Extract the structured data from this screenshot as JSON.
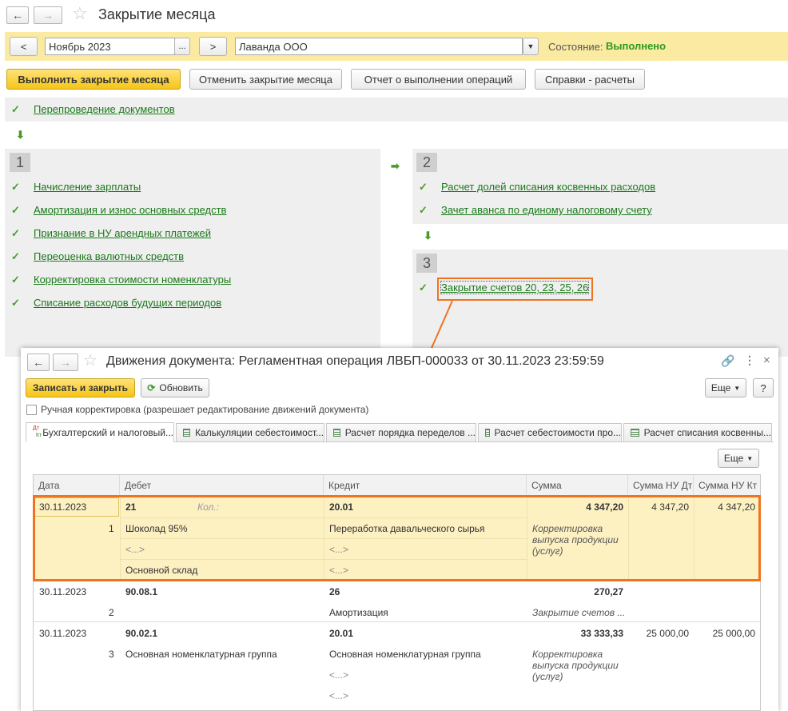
{
  "window": {
    "title": "Закрытие месяца"
  },
  "filters": {
    "prev": "<",
    "period": "Ноябрь 2023",
    "period_btn": "...",
    "next": ">",
    "org": "Лаванда ООО",
    "status_label": "Состояние:",
    "status_value": "Выполнено"
  },
  "toolbar": {
    "run": "Выполнить закрытие месяца",
    "cancel": "Отменить закрытие месяца",
    "report": "Отчет о выполнении операций",
    "refs": "Справки - расчеты"
  },
  "top_op": "Перепроведение документов",
  "block1": {
    "num": "1",
    "items": [
      "Начисление зарплаты",
      "Амортизация и износ основных средств",
      "Признание в НУ арендных платежей",
      "Переоценка валютных средств",
      "Корректировка стоимости номенклатуры",
      "Списание расходов будущих периодов"
    ]
  },
  "block2": {
    "num": "2",
    "items": [
      "Расчет долей списания косвенных расходов",
      "Зачет аванса по единому налоговому счету"
    ]
  },
  "block3": {
    "num": "3",
    "items": [
      "Закрытие счетов 20, 23, 25, 26"
    ]
  },
  "doc": {
    "title": "Движения документа: Регламентная операция ЛВБП-000033 от 30.11.2023 23:59:59",
    "save_close": "Записать и закрыть",
    "refresh": "Обновить",
    "more": "Еще",
    "help": "?",
    "manual": "Ручная корректировка (разрешает редактирование движений документа)",
    "tabs": [
      "Бухгалтерский и налоговый...",
      "Калькуляции себестоимост...",
      "Расчет порядка переделов ...",
      "Расчет себестоимости про...",
      "Расчет списания косвенны..."
    ],
    "tab_dt": "Дт",
    "tab_kt": "Кт",
    "table_more": "Еще",
    "columns": [
      "Дата",
      "Дебет",
      "Кредит",
      "Сумма",
      "Сумма НУ Дт",
      "Сумма НУ Кт"
    ],
    "rows": [
      {
        "date": "30.11.2023",
        "n": "1",
        "dt": "21",
        "dt_qty": "Кол.:",
        "dt_sub": [
          "Шоколад 95%",
          "<...>",
          "Основной склад"
        ],
        "kt": "20.01",
        "kt_sub": [
          "Переработка давальческого сырья",
          "<...>",
          "<...>"
        ],
        "sum": "4 347,20",
        "content": "Корректировка выпуска продукции (услуг)",
        "nu_dt": "4 347,20",
        "nu_kt": "4 347,20"
      },
      {
        "date": "30.11.2023",
        "n": "2",
        "dt": "90.08.1",
        "kt": "26",
        "kt_sub": [
          "Амортизация"
        ],
        "sum": "270,27",
        "content": "Закрытие счетов ..."
      },
      {
        "date": "30.11.2023",
        "n": "3",
        "dt": "90.02.1",
        "dt_sub": [
          "Основная номенклатурная группа"
        ],
        "kt": "20.01",
        "kt_sub": [
          "Основная номенклатурная группа",
          "<...>",
          "<...>"
        ],
        "sum": "33 333,33",
        "content": "Корректировка выпуска продукции (услуг)",
        "nu_dt": "25 000,00",
        "nu_kt": "25 000,00"
      }
    ]
  },
  "colors": {
    "accent": "#f07320",
    "highlight": "#fdf1c2",
    "link": "#1a7a1a",
    "status": "#2d9a1e",
    "yellow_bar": "#fbeaa2"
  }
}
